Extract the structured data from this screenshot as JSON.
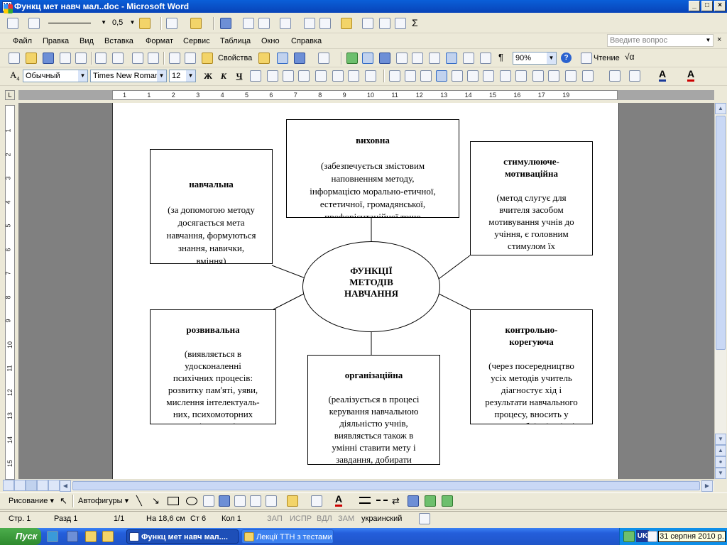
{
  "window": {
    "title": "Функц мет навч мал..doc - Microsoft Word",
    "min": "_",
    "max": "□",
    "close": "×"
  },
  "menubar": {
    "items": [
      "Файл",
      "Правка",
      "Вид",
      "Вставка",
      "Формат",
      "Сервис",
      "Таблица",
      "Окно",
      "Справка"
    ],
    "help_placeholder": "Введите вопрос"
  },
  "drawing_toolbar_top": {
    "line_width": "0,5"
  },
  "standard_toolbar": {
    "properties_label": "Свойства",
    "zoom": "90%",
    "read_label": "Чтение"
  },
  "formatting_toolbar": {
    "style": "Обычный",
    "font": "Times New Roman",
    "size": "12",
    "bold": "Ж",
    "italic": "К",
    "underline": "Ч"
  },
  "ruler": {
    "h_numbers": [
      "1",
      "1",
      "2",
      "3",
      "4",
      "5",
      "6",
      "7",
      "8",
      "9",
      "10",
      "11",
      "12",
      "13",
      "14",
      "15",
      "16",
      "17",
      "19"
    ],
    "v_numbers": [
      "1",
      "2",
      "3",
      "4",
      "5",
      "6",
      "7",
      "8",
      "9",
      "10",
      "11",
      "12",
      "13",
      "14",
      "15"
    ]
  },
  "diagram": {
    "center": "ФУНКЦІЇ\nМЕТОДІВ\nНАВЧАННЯ",
    "boxes": [
      {
        "title": "виховна",
        "body": "(забезпечується змістовим\nнаповненням методу,\nінформацією морально-етичної,\nестетичної, громадянської,\nпрофорієнтаційної тощо\nспрямованості)"
      },
      {
        "title": "навчальна",
        "body": "(за допомогою методу\nдосягається мета\nнавчання, формуються\nзнання, навички,\nвміння)"
      },
      {
        "title": "стимулююче-\nмотиваційна",
        "body": "(метод слугує для\nвчителя засобом\nмотивування учнів до\nучіння, є головним\nстимулом їх\nпізнавальної діяльності)"
      },
      {
        "title": "розвивальна",
        "body": "(виявляється в\nудосконаленні\nпсихічних процесів:\nрозвитку пам'яті, уяви,\nмислення інтелектуаль-\nних, психомоторних\nвмінь тощо)"
      },
      {
        "title": "організаційна",
        "body": "(реалізується в процесі\nкерування навчальною\nдіяльністю учнів,\nвиявляється також в\nумінні ставити мету і\nзавдання, добирати\nзасоби досягнення тощо)"
      },
      {
        "title": "контрольно-\nкорегуюча",
        "body": "(через посередництво\nусіх методів учитель\nдіагностує хід і\nрезультати навчального\nпроцесу, вносить у\nнього необхідні зміни)"
      }
    ]
  },
  "drawbar": {
    "drawing": "Рисование",
    "autoshapes": "Автофигуры"
  },
  "status": {
    "page": "Стр.  1",
    "section": "Разд  1",
    "pages": "1/1",
    "position": "На  18,6 см",
    "line": "Ст  6",
    "col": "Кол  1",
    "rec": "ЗАП",
    "trk": "ИСПР",
    "ext": "ВДЛ",
    "ovr": "ЗАМ",
    "lang": "украинский"
  },
  "taskbar": {
    "start": "Пуск",
    "tasks": [
      "Функц мет навч мал....",
      "Лекції ТТН з тестами"
    ],
    "lang": "UK",
    "clock": "31 серпня 2010 р."
  }
}
